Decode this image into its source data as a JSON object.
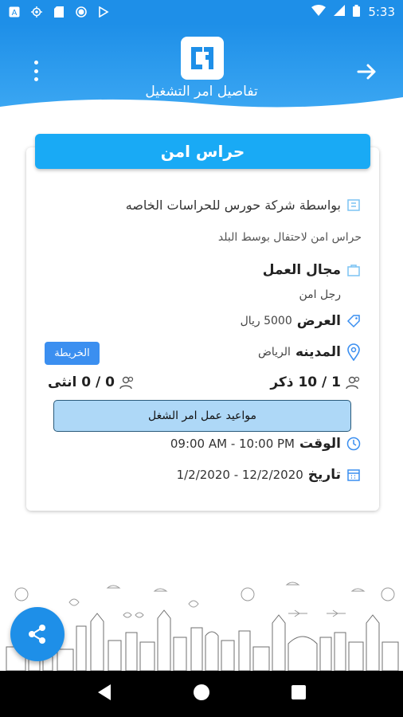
{
  "status_bar": {
    "time": "5:33",
    "left_icons": [
      "a-icon",
      "gps-icon",
      "sd-icon",
      "circle-icon",
      "play-store-icon"
    ],
    "right_icons": [
      "wifi-icon",
      "signal-icon",
      "battery-icon"
    ]
  },
  "header": {
    "title": "تفاصيل امر التشغيل",
    "logo_text": "GA",
    "colors": {
      "primary": "#1e8fe8",
      "title_bar": "#19aaf5"
    }
  },
  "job": {
    "title": "حراس امن",
    "company": "بواسطة شركة حورس للحراسات الخاصه",
    "description": "حراس امن لاحتفال بوسط البلد",
    "field_label": "مجال العمل",
    "field_value": "رجل امن",
    "offer_label": "العرض",
    "offer_value": "5000 ريال",
    "city_label": "المدينه",
    "city_value": "الرياض",
    "map_button": "الخريطة",
    "male_count": "1 / 10 ذكر",
    "female_count": "0 / 0 انثى",
    "schedule_button": "مواعيد عمل امر الشغل",
    "time_label": "الوقت",
    "time_value": "09:00 AM - 10:00 PM",
    "date_label": "تاريخ",
    "date_value": "1/2/2020 - 12/2/2020"
  }
}
